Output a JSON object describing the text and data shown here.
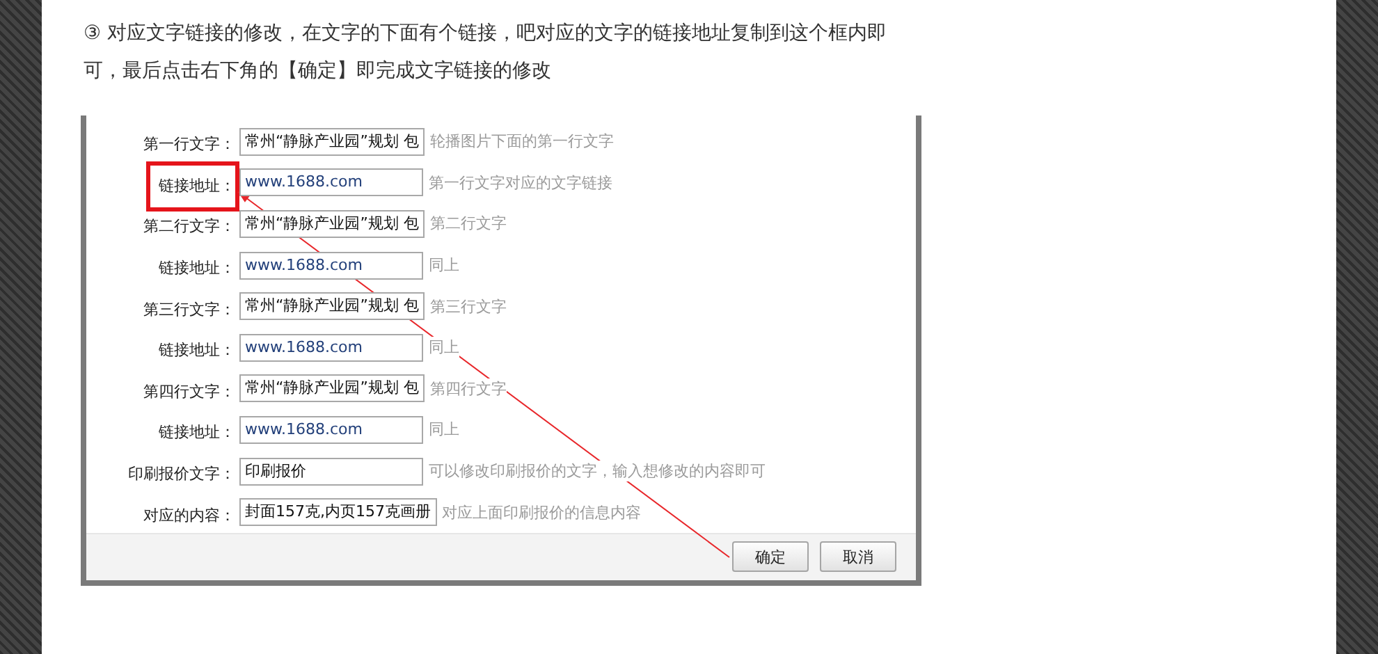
{
  "instruction": "③ 对应文字链接的修改，在文字的下面有个链接，吧对应的文字的链接地址复制到这个框内即可，最后点击右下角的【确定】即完成文字链接的修改",
  "form": {
    "rows": [
      {
        "label": "第一行文字：",
        "value": "常州“静脉产业园”规划 包",
        "hint": "轮播图片下面的第一行文字",
        "kind": "text",
        "highlighted": false
      },
      {
        "label": "链接地址：",
        "value": "www.1688.com",
        "hint": "第一行文字对应的文字链接",
        "kind": "link",
        "highlighted": true
      },
      {
        "label": "第二行文字：",
        "value": "常州“静脉产业园”规划 包",
        "hint": "第二行文字",
        "kind": "text",
        "highlighted": false
      },
      {
        "label": "链接地址：",
        "value": "www.1688.com",
        "hint": "同上",
        "kind": "link",
        "highlighted": false
      },
      {
        "label": "第三行文字：",
        "value": "常州“静脉产业园”规划 包",
        "hint": "第三行文字",
        "kind": "text",
        "highlighted": false
      },
      {
        "label": "链接地址：",
        "value": "www.1688.com",
        "hint": "同上",
        "kind": "link",
        "highlighted": false
      },
      {
        "label": "第四行文字：",
        "value": "常州“静脉产业园”规划 包",
        "hint": "第四行文字",
        "kind": "text",
        "highlighted": false
      },
      {
        "label": "链接地址：",
        "value": "www.1688.com",
        "hint": "同上",
        "kind": "link",
        "highlighted": false
      },
      {
        "label": "印刷报价文字：",
        "value": "印刷报价",
        "hint": "可以修改印刷报价的文字，输入想修改的内容即可",
        "kind": "text",
        "highlighted": false
      },
      {
        "label": "对应的内容：",
        "value": "封面157克,内页157克画册",
        "hint": "对应上面印刷报价的信息内容",
        "kind": "text",
        "highlighted": false
      }
    ],
    "buttons": [
      {
        "label": "确定",
        "kind": "confirm"
      },
      {
        "label": "取消",
        "kind": "cancel"
      }
    ]
  }
}
